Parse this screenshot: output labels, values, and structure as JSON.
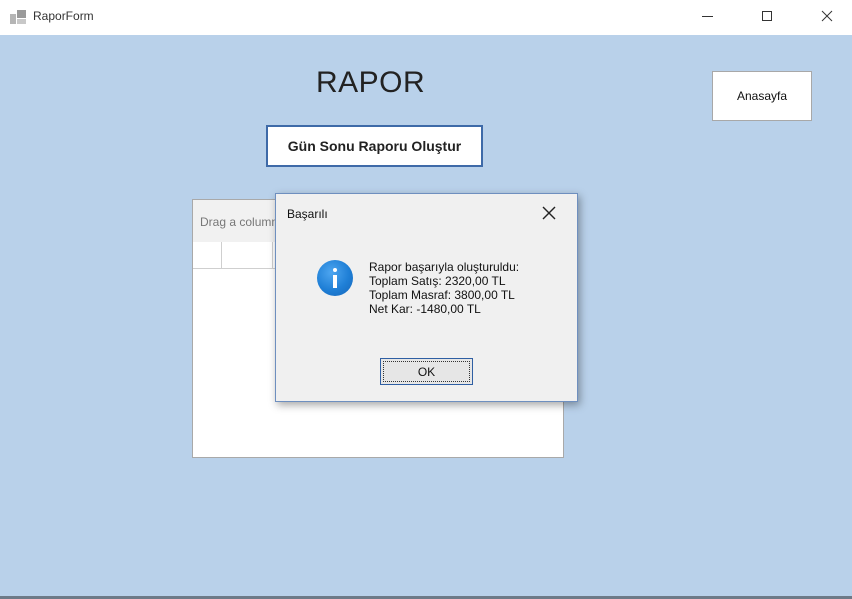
{
  "window": {
    "title": "RaporForm",
    "min_glyph": "",
    "close_glyph": "✕"
  },
  "main": {
    "title": "RAPOR",
    "home_button": "Anasayfa",
    "report_button": "Gün Sonu Raporu Oluştur",
    "grid_group_text": "Drag a column header here to group by that column"
  },
  "dialog": {
    "title": "Başarılı",
    "close_glyph": "✕",
    "message_lines": [
      "Rapor başarıyla oluşturuldu:",
      "Toplam Satış: 2320,00 TL",
      "Toplam Masraf: 3800,00 TL",
      "Net Kar: -1480,00 TL"
    ],
    "ok_label": "OK"
  },
  "colors": {
    "form_background": "#b9d1ea",
    "dialog_background": "#f0f0f0",
    "accent_border": "#3e6aa8",
    "info_icon": "#1f7fd6"
  }
}
